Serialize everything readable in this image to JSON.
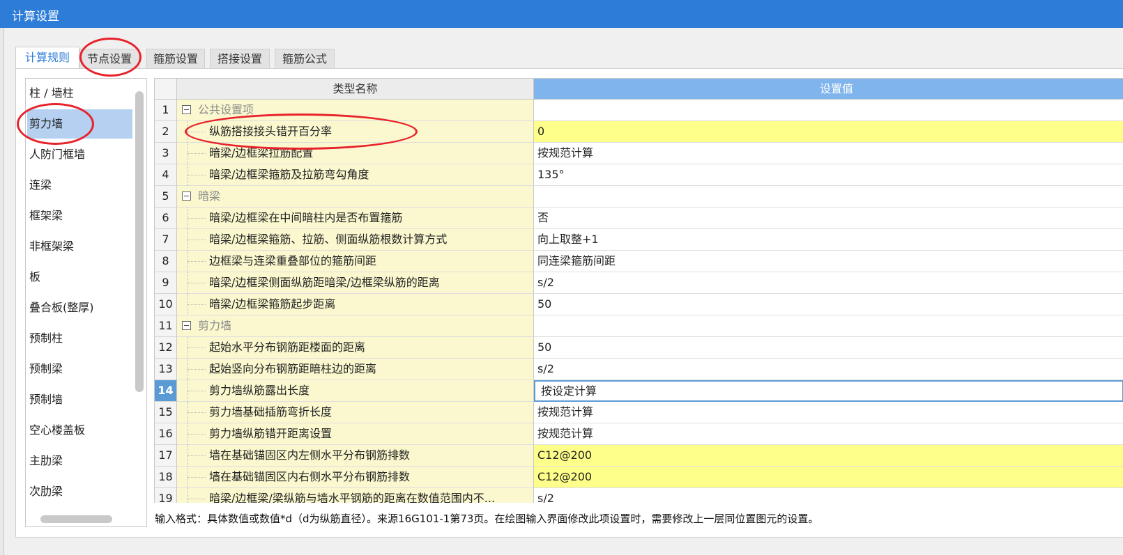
{
  "window": {
    "title": "计算设置"
  },
  "tabs": [
    {
      "label": "计算规则",
      "active": true
    },
    {
      "label": "节点设置",
      "active": false
    },
    {
      "label": "箍筋设置",
      "active": false
    },
    {
      "label": "搭接设置",
      "active": false
    },
    {
      "label": "箍筋公式",
      "active": false
    }
  ],
  "component_list": [
    "柱 / 墙柱",
    "剪力墙",
    "人防门框墙",
    "连梁",
    "框架梁",
    "非框架梁",
    "板",
    "叠合板(整厚)",
    "预制柱",
    "预制梁",
    "预制墙",
    "空心楼盖板",
    "主肋梁",
    "次肋梁"
  ],
  "selected_component": "剪力墙",
  "table": {
    "headers": {
      "name": "类型名称",
      "value": "设置值"
    },
    "rows": [
      {
        "num": "1",
        "name": "公共设置项",
        "value": "",
        "group": true
      },
      {
        "num": "2",
        "name": "纵筋搭接接头错开百分率",
        "value": "0",
        "highlight": true
      },
      {
        "num": "3",
        "name": "暗梁/边框梁拉筋配置",
        "value": "按规范计算"
      },
      {
        "num": "4",
        "name": "暗梁/边框梁箍筋及拉筋弯勾角度",
        "value": "135°"
      },
      {
        "num": "5",
        "name": "暗梁",
        "value": "",
        "group": true
      },
      {
        "num": "6",
        "name": "暗梁/边框梁在中间暗柱内是否布置箍筋",
        "value": "否"
      },
      {
        "num": "7",
        "name": "暗梁/边框梁箍筋、拉筋、侧面纵筋根数计算方式",
        "value": "向上取整+1"
      },
      {
        "num": "8",
        "name": "边框梁与连梁重叠部位的箍筋间距",
        "value": "同连梁箍筋间距"
      },
      {
        "num": "9",
        "name": "暗梁/边框梁侧面纵筋距暗梁/边框梁纵筋的距离",
        "value": "s/2"
      },
      {
        "num": "10",
        "name": "暗梁/边框梁箍筋起步距离",
        "value": "50"
      },
      {
        "num": "11",
        "name": "剪力墙",
        "value": "",
        "group": true
      },
      {
        "num": "12",
        "name": "起始水平分布钢筋距楼面的距离",
        "value": "50"
      },
      {
        "num": "13",
        "name": "起始竖向分布钢筋距暗柱边的距离",
        "value": "s/2"
      },
      {
        "num": "14",
        "name": "剪力墙纵筋露出长度",
        "value": "按设定计算",
        "active": true
      },
      {
        "num": "15",
        "name": "剪力墙基础插筋弯折长度",
        "value": "按规范计算"
      },
      {
        "num": "16",
        "name": "剪力墙纵筋错开距离设置",
        "value": "按规范计算"
      },
      {
        "num": "17",
        "name": "墙在基础锚固区内左侧水平分布钢筋排数",
        "value": "C12@200",
        "highlight": true
      },
      {
        "num": "18",
        "name": "墙在基础锚固区内右侧水平分布钢筋排数",
        "value": "C12@200",
        "highlight": true
      },
      {
        "num": "19",
        "name": "暗梁/边框梁/梁纵筋与墙水平钢筋的距离在数值范围内不...",
        "value": "s/2"
      }
    ]
  },
  "hint_text": "输入格式：具体数值或数值*d（d为纵筋直径）。来源16G101-1第73页。在绘图输入界面修改此项设置时，需要修改上一层同位置图元的设置。",
  "colors": {
    "title_bar": "#2d7cd7",
    "header_value": "#7fb4ec",
    "name_cell": "#fbf8cf",
    "highlight_cell": "#fefe8a",
    "selected_item": "#b5d0f0",
    "annotation_red": "#e8222b"
  }
}
